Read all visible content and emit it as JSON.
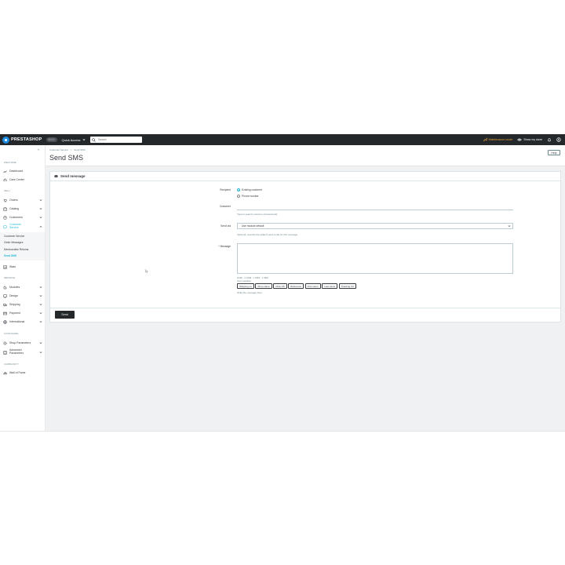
{
  "topbar": {
    "logo_text": "PRESTASHOP",
    "version": "9.0.0",
    "quick_access": "Quick Access",
    "search_placeholder": "Search",
    "maintenance": "Maintenance mode",
    "show_store": "Show my store"
  },
  "sidebar": {
    "sections": {
      "welcome": "WELCOME",
      "sell": "SELL",
      "improve": "IMPROVE",
      "configure": "CONFIGURE",
      "community": "COMMUNITY"
    },
    "items": {
      "dashboard": "Dashboard",
      "care_center": "Care Center",
      "orders": "Orders",
      "catalog": "Catalog",
      "customers": "Customers",
      "customer_service": "Customer Service",
      "stats": "Stats",
      "modules": "Modules",
      "design": "Design",
      "shipping": "Shipping",
      "payment": "Payment",
      "international": "International",
      "shop_parameters": "Shop Parameters",
      "advanced_parameters": "Advanced Parameters",
      "wall_of_fame": "Wall of Fame"
    },
    "subitems": {
      "customer_service": "Customer Service",
      "order_messages": "Order Messages",
      "merchandise_returns": "Merchandise Returns",
      "send_sms": "Send SMS"
    }
  },
  "header": {
    "breadcrumb_parent": "Customer Service",
    "breadcrumb_sep": ">",
    "breadcrumb_current": "Send SMS",
    "title": "Send SMS",
    "help": "Help"
  },
  "form": {
    "card_title": "Send message",
    "recipient_label": "Recipient",
    "recipient_options": [
      "Existing customer",
      "Phone number"
    ],
    "customer_label": "Customer",
    "customer_help": "Type to search customer (name/email).",
    "send_via_label": "Send via",
    "send_via_value": "Use module default",
    "send_via_help": "Optional: override the default send mode for this message.",
    "message_label": "* Message",
    "counter": "0/160 · 0 GSM · 1 SMS · 1 SMS",
    "insert_vars_label": "Insert variables:",
    "variables": [
      "Shipping no",
      "Shop name",
      "Order ID",
      "Reference",
      "First name",
      "Last name",
      "Tracking Url"
    ],
    "message_help": "Write the message here.",
    "send_label": "Send"
  },
  "colors": {
    "topbar": "#25282b",
    "accent": "#25b9d7",
    "maintenance": "#e8a33d"
  }
}
